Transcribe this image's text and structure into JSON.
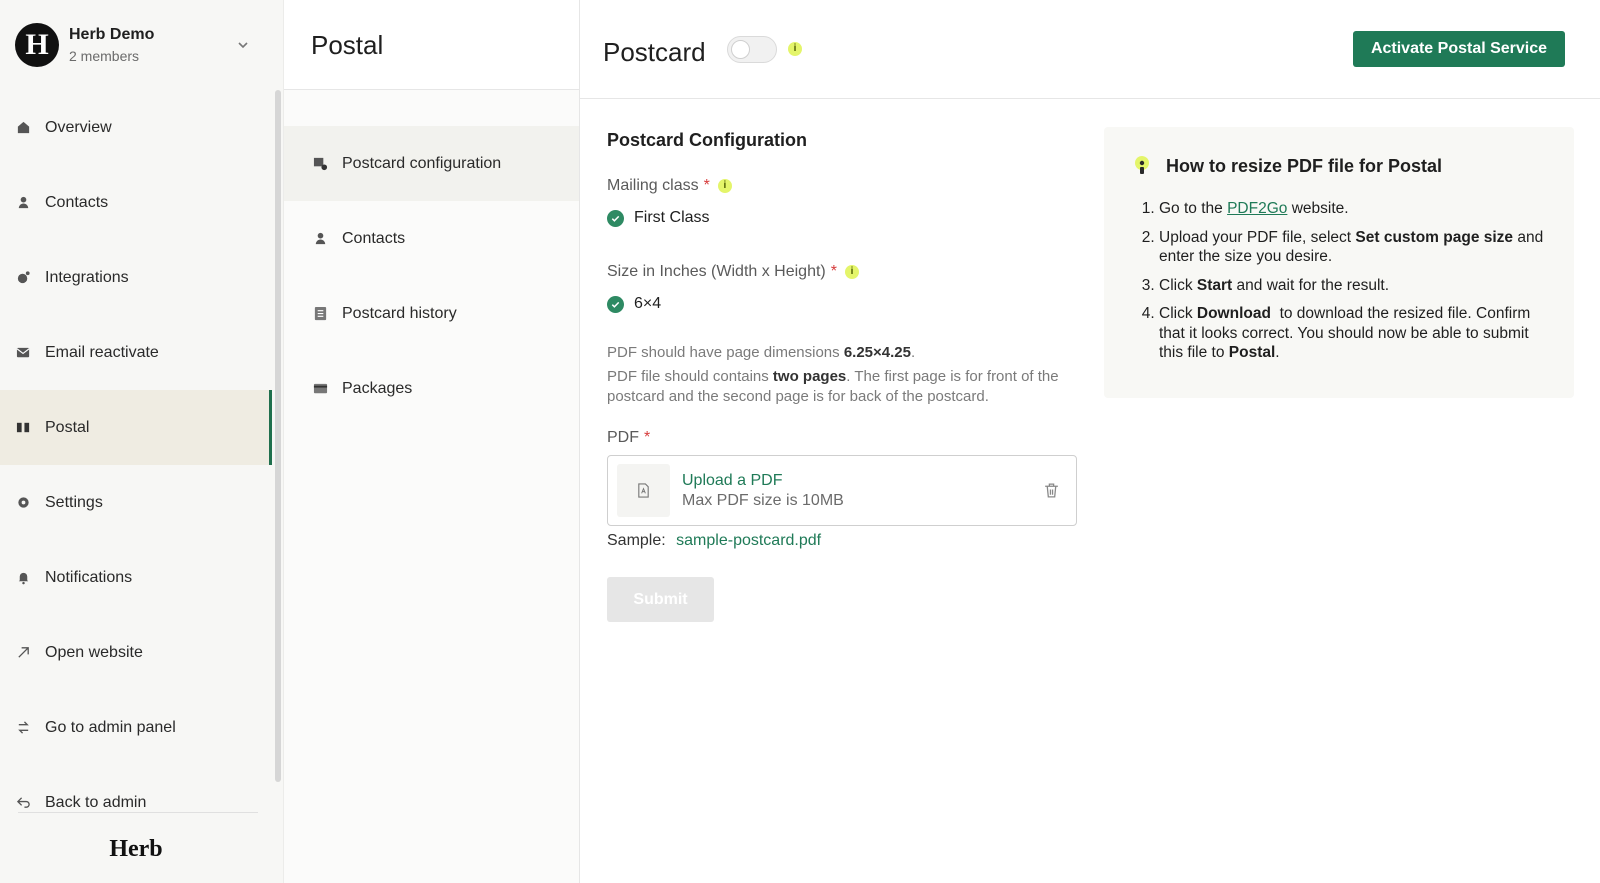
{
  "org": {
    "avatar_letter": "H",
    "name": "Herb Demo",
    "members": "2 members"
  },
  "sidebar": {
    "items": [
      {
        "label": "Overview",
        "icon": "home-icon"
      },
      {
        "label": "Contacts",
        "icon": "person-icon"
      },
      {
        "label": "Integrations",
        "icon": "integrations-icon"
      },
      {
        "label": "Email reactivate",
        "icon": "email-icon"
      },
      {
        "label": "Postal",
        "icon": "postal-icon",
        "active": true
      },
      {
        "label": "Settings",
        "icon": "gear-icon"
      },
      {
        "label": "Notifications",
        "icon": "bell-icon"
      },
      {
        "label": "Open website",
        "icon": "external-link-icon"
      },
      {
        "label": "Go to admin panel",
        "icon": "swap-icon"
      },
      {
        "label": "Back to admin",
        "icon": "back-icon"
      }
    ],
    "brand": "Herb"
  },
  "subnav": {
    "title": "Postal",
    "items": [
      {
        "label": "Postcard configuration",
        "icon": "postcard-config-icon",
        "active": true
      },
      {
        "label": "Contacts",
        "icon": "person-icon"
      },
      {
        "label": "Postcard history",
        "icon": "list-icon"
      },
      {
        "label": "Packages",
        "icon": "card-icon"
      }
    ]
  },
  "main": {
    "title": "Postcard",
    "info": "i",
    "activate_label": "Activate Postal Service",
    "config": {
      "title": "Postcard Configuration",
      "mailing_label": "Mailing class",
      "mailing_value": "First Class",
      "size_label": "Size in Inches (Width x Height)",
      "size_value": "6×4",
      "required_mark": "*",
      "hint1_prefix": "PDF should have page dimensions ",
      "hint1_bold": "6.25×4.25",
      "hint1_suffix": ".",
      "hint2_prefix": "PDF file should contains ",
      "hint2_bold": "two pages",
      "hint2_suffix": ". The first page is for front of the postcard and the second page is for back of the postcard.",
      "pdf_label": "PDF",
      "upload_link": "Upload a PDF",
      "upload_sub": "Max PDF size is 10MB",
      "sample_label": "Sample:",
      "sample_link": "sample-postcard.pdf",
      "submit_label": "Submit"
    },
    "help": {
      "title": "How to resize PDF file for Postal",
      "step1_a": "Go to the ",
      "step1_link": "PDF2Go",
      "step1_b": " website.",
      "step2_a": "Upload your PDF file, select ",
      "step2_bold": "Set custom page size",
      "step2_b": " and enter the size you desire.",
      "step3_a": "Click ",
      "step3_bold": "Start",
      "step3_b": " and wait for the result.",
      "step4_a": "Click ",
      "step4_bold": "Download",
      "step4_b": "  to download the resized file. Confirm that it looks correct. You should now be able to submit this file to ",
      "step4_bold2": "Postal",
      "step4_c": "."
    }
  },
  "colors": {
    "accent": "#1f7a57",
    "active_bg": "#efece2",
    "info": "#e4f56a",
    "required": "#d63b3b"
  }
}
